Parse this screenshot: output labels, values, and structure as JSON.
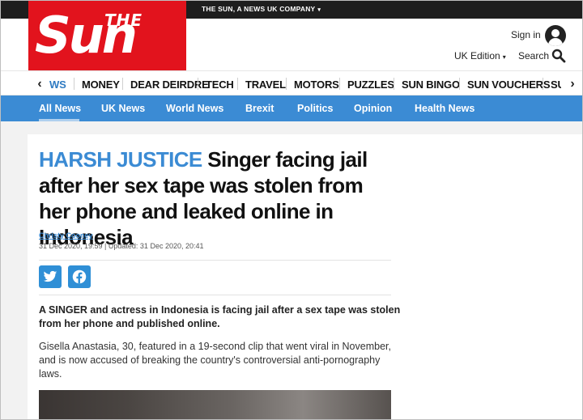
{
  "topbar": {
    "company": "THE SUN, A NEWS UK COMPANY",
    "company_caret": "▾"
  },
  "logo": {
    "the": "THE",
    "sun": "Sun"
  },
  "header": {
    "signin": "Sign in",
    "edition": "UK Edition",
    "edition_caret": "▾",
    "search": "Search"
  },
  "nav": {
    "left_arrow": "‹",
    "right_arrow": "›",
    "items": [
      "WS",
      "MONEY",
      "DEAR DEIRDRE",
      "TECH",
      "TRAVEL",
      "MOTORS",
      "PUZZLES",
      "SUN BINGO",
      "SUN VOUCHERS",
      "SU"
    ]
  },
  "news_nav": {
    "items": [
      "All News",
      "UK News",
      "World News",
      "Brexit",
      "Politics",
      "Opinion",
      "Health News"
    ]
  },
  "article": {
    "kicker": "HARSH JUSTICE",
    "headline": " Singer facing jail after her sex tape was stolen from her phone and leaked online in Indonesia",
    "author": "Christy Cooney",
    "dates": "31 Dec 2020, 19:59 | Updated: 31 Dec 2020, 20:41",
    "lede": "A SINGER and actress in Indonesia is facing jail after a sex tape was stolen from her phone and published online.",
    "paragraph": "Gisella Anastasia, 30, featured in a 19-second clip that went viral in November, and is now accused of breaking the country's controversial anti-pornography laws."
  },
  "colors": {
    "brand_red": "#e2131d",
    "accent_blue": "#3b8bd4",
    "top_strip": "#1e1e1e"
  },
  "icons": [
    "user-icon",
    "search-icon",
    "chevron-left-icon",
    "chevron-right-icon",
    "twitter-icon",
    "facebook-icon"
  ]
}
